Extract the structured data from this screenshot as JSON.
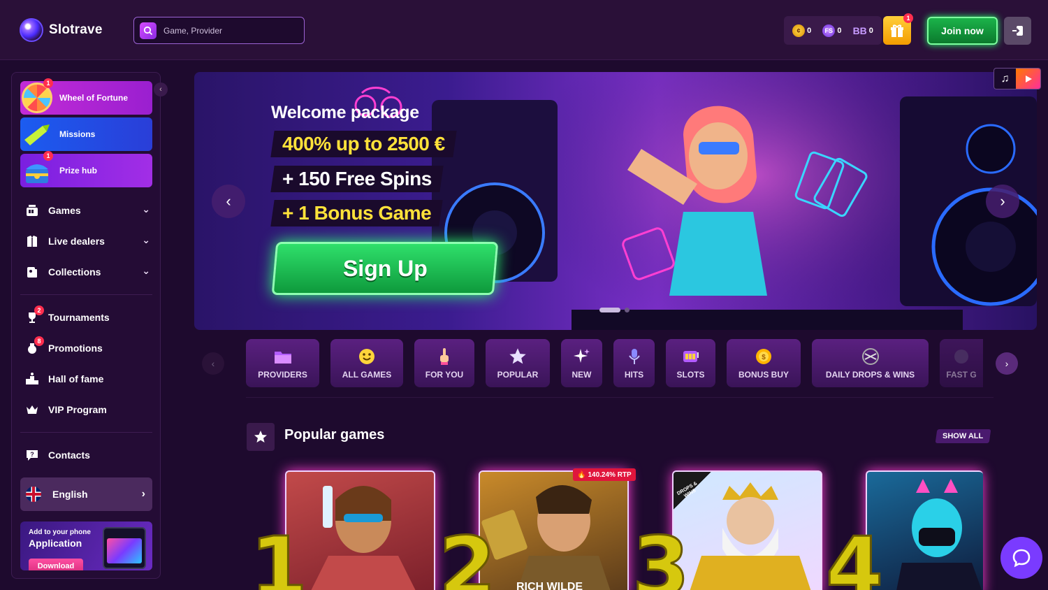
{
  "header": {
    "logo_text": "Slotrave",
    "search_placeholder": "Game, Provider",
    "balances": [
      {
        "icon": "coin-icon",
        "value": "0"
      },
      {
        "icon": "free-spins-icon",
        "label": "FS",
        "value": "0"
      },
      {
        "icon": "bonus-balance-icon",
        "label": "BB",
        "value": "0"
      }
    ],
    "gift_badge": "1",
    "join_label": "Join now"
  },
  "sidebar": {
    "promos": [
      {
        "label": "Wheel of Fortune",
        "badge": "1"
      },
      {
        "label": "Missions"
      },
      {
        "label": "Prize hub",
        "badge": "1"
      }
    ],
    "menus": [
      {
        "label": "Games"
      },
      {
        "label": "Live dealers"
      },
      {
        "label": "Collections"
      }
    ],
    "links": [
      {
        "label": "Tournaments",
        "badge": "2"
      },
      {
        "label": "Promotions",
        "badge": "8"
      },
      {
        "label": "Hall of fame"
      },
      {
        "label": "VIP Program"
      }
    ],
    "contacts_label": "Contacts",
    "language": "English",
    "app": {
      "small": "Add to your phone",
      "big": "Application",
      "button": "Download"
    }
  },
  "banner": {
    "title": "Welcome package",
    "line1": "400% up to 2500 €",
    "line2": "+ 150 Free Spins",
    "line3": "+ 1 Bonus Game",
    "cta": "Sign Up"
  },
  "categories": [
    {
      "label": "PROVIDERS",
      "icon": "folder-icon"
    },
    {
      "label": "ALL GAMES",
      "icon": "smiley-icon"
    },
    {
      "label": "FOR YOU",
      "icon": "finger-icon"
    },
    {
      "label": "POPULAR",
      "icon": "star-icon"
    },
    {
      "label": "NEW",
      "icon": "sparkle-icon"
    },
    {
      "label": "HITS",
      "icon": "microphone-icon"
    },
    {
      "label": "SLOTS",
      "icon": "slot-icon"
    },
    {
      "label": "BONUS BUY",
      "icon": "coin-icon"
    },
    {
      "label": "DAILY DROPS & WINS",
      "icon": "drops-wins-icon"
    },
    {
      "label": "FAST G",
      "icon": "fast-games-icon"
    }
  ],
  "popular": {
    "title": "Popular games",
    "show_all": "SHOW ALL",
    "rtp_badge": "140.24% RTP",
    "card2_title": "RICH WILDE",
    "drops_badge": "DROPS & WINS",
    "ranks": [
      "1",
      "2",
      "3",
      "4"
    ]
  },
  "colors": {
    "background": "#1e0a2e",
    "header": "#2a1038",
    "accent_green": "#1bb34a",
    "accent_purple": "#9c63d4",
    "badge_red": "#ff2e4e"
  }
}
